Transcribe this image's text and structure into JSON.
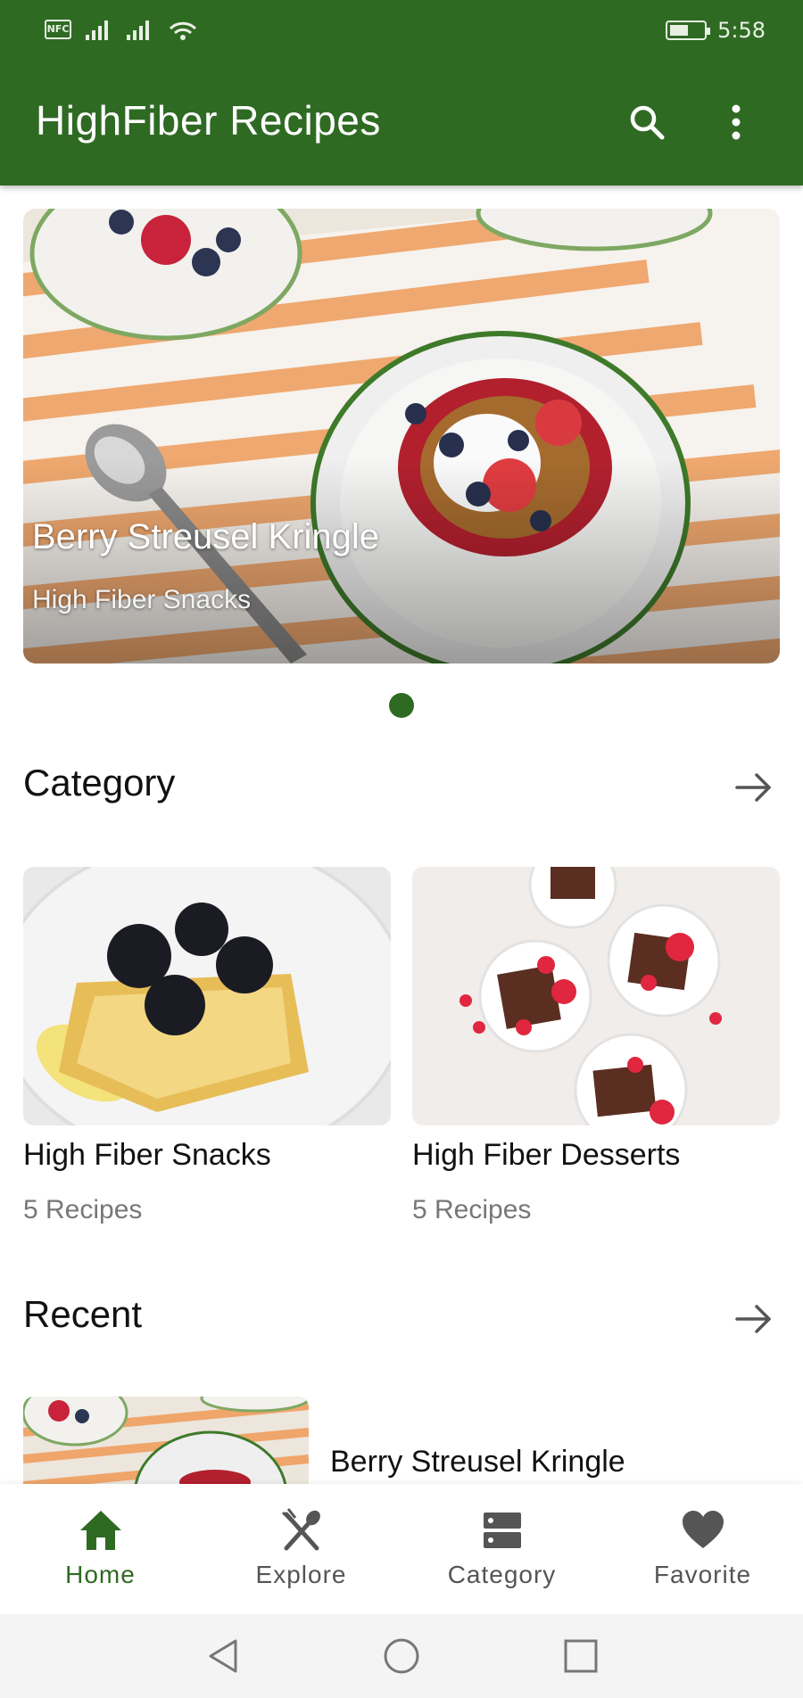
{
  "status_bar": {
    "nfc_label": "NFC",
    "time": "5:58",
    "battery_level": 0.55
  },
  "app_bar": {
    "title": "HighFiber Recipes",
    "search_icon": "search-icon",
    "more_icon": "more-vert-icon"
  },
  "featured": {
    "title": "Berry Streusel Kringle",
    "subtitle": "High Fiber Snacks",
    "page_count": 1,
    "current_page": 1
  },
  "category_section": {
    "title": "Category",
    "items": [
      {
        "name": "High Fiber Snacks",
        "count": "5 Recipes"
      },
      {
        "name": "High Fiber Desserts",
        "count": "5 Recipes"
      }
    ]
  },
  "recent_section": {
    "title": "Recent",
    "items": [
      {
        "title": "Berry Streusel Kringle"
      }
    ]
  },
  "bottom_nav": {
    "items": [
      {
        "label": "Home",
        "icon": "home-icon",
        "active": true
      },
      {
        "label": "Explore",
        "icon": "utensils-icon",
        "active": false
      },
      {
        "label": "Category",
        "icon": "category-icon",
        "active": false
      },
      {
        "label": "Favorite",
        "icon": "heart-icon",
        "active": false
      }
    ]
  },
  "colors": {
    "primary": "#2f6a23",
    "text": "#111111",
    "muted": "#777777"
  }
}
